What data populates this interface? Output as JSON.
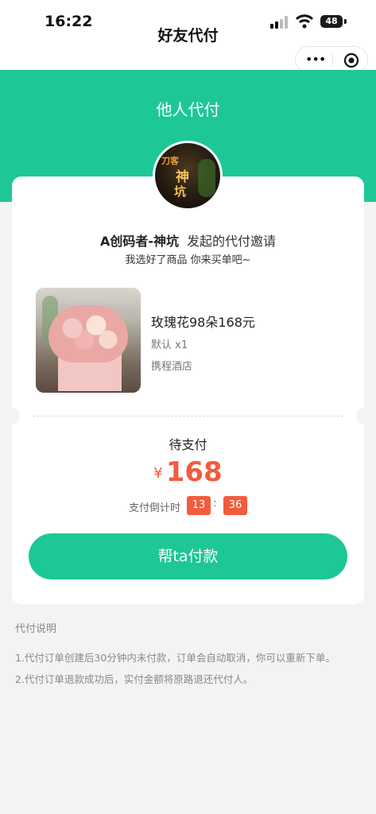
{
  "status_bar": {
    "time": "16:22",
    "battery": "48"
  },
  "nav": {
    "title": "好友代付",
    "more_icon": "more-dots-icon",
    "close_icon": "target-circle-icon"
  },
  "banner": {
    "title": "他人代付"
  },
  "invite": {
    "name": "A创码者-神坑",
    "text": "发起的代付邀请",
    "message": "我选好了商品 你来买单吧~"
  },
  "avatar": {
    "line1": "刀客",
    "line2": "神",
    "line3": "坑"
  },
  "product": {
    "name": "玫瑰花98朵168元",
    "spec": "默认 x1",
    "shop": "携程酒店"
  },
  "payment": {
    "status": "待支付",
    "currency": "¥",
    "amount": "168",
    "countdown_label": "支付倒计时",
    "countdown_min": "13",
    "countdown_colon": ":",
    "countdown_sec": "36",
    "button": "帮ta付款"
  },
  "notes": {
    "title": "代付说明",
    "items": [
      "1.代付订单创建后30分钟内未付款，订单会自动取消，你可以重新下单。",
      "2.代付订单退款成功后，实付金额将原路退还代付人。"
    ]
  },
  "colors": {
    "primary": "#1ec796",
    "price": "#f15c3e"
  }
}
